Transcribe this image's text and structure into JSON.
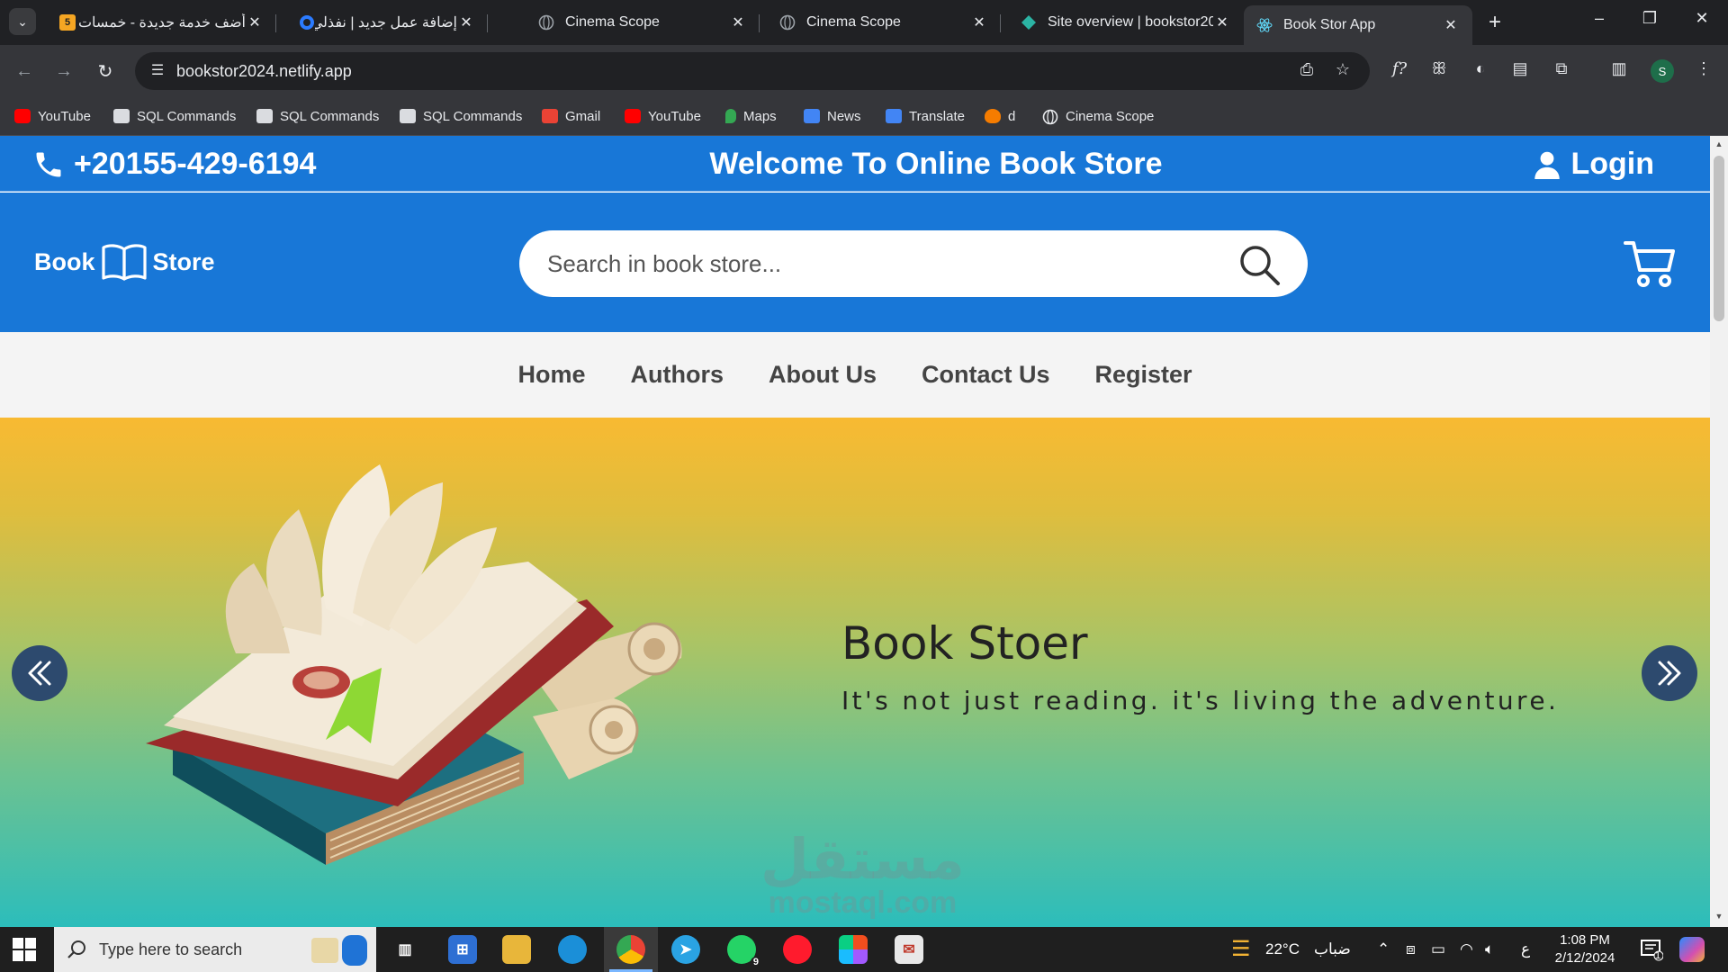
{
  "browser": {
    "tabs": [
      {
        "title": "أضف خدمة جديدة - خمسات",
        "favicon_text": "5",
        "favicon_color": "#f5a623"
      },
      {
        "title": "إضافة عمل جديد | نفذلي",
        "favicon_text": "",
        "favicon_color": "#2b7bff"
      },
      {
        "title": "Cinema Scope",
        "favicon_text": "",
        "favicon_color": "#9aa0a6"
      },
      {
        "title": "Cinema Scope",
        "favicon_text": "",
        "favicon_color": "#9aa0a6"
      },
      {
        "title": "Site overview | bookstor20",
        "favicon_text": "",
        "favicon_color": "#2bb3a3"
      },
      {
        "title": "Book Stor App",
        "favicon_text": "",
        "favicon_color": "#61dafb"
      }
    ],
    "active_tab_index": 5,
    "url": "bookstor2024.netlify.app",
    "profile_initial": "S",
    "bookmarks": [
      {
        "label": "YouTube",
        "icon": "youtube-icon",
        "color": "#ff0000"
      },
      {
        "label": "SQL Commands",
        "icon": "page-icon",
        "color": "#dadce0"
      },
      {
        "label": "SQL Commands",
        "icon": "page-icon",
        "color": "#dadce0"
      },
      {
        "label": "SQL Commands",
        "icon": "page-icon",
        "color": "#dadce0"
      },
      {
        "label": "Gmail",
        "icon": "gmail-icon",
        "color": "#ea4335"
      },
      {
        "label": "YouTube",
        "icon": "youtube-icon",
        "color": "#ff0000"
      },
      {
        "label": "Maps",
        "icon": "maps-icon",
        "color": "#34a853"
      },
      {
        "label": "News",
        "icon": "news-icon",
        "color": "#4285f4"
      },
      {
        "label": "Translate",
        "icon": "translate-icon",
        "color": "#4285f4"
      },
      {
        "label": "d",
        "icon": "fire-icon",
        "color": "#f57c00"
      },
      {
        "label": "Cinema Scope",
        "icon": "globe-icon",
        "color": "#e8eaed"
      }
    ]
  },
  "page": {
    "topbar": {
      "phone": "+20155-429-6194",
      "welcome": "Welcome To Online Book Store",
      "login": "Login"
    },
    "header": {
      "logo_left": "Book",
      "logo_right": "Store",
      "search_placeholder": "Search in book store..."
    },
    "nav": [
      "Home",
      "Authors",
      "About Us",
      "Contact Us",
      "Register"
    ],
    "hero": {
      "title": "Book Stoer",
      "subtitle": "It's not just reading. it's living the adventure."
    },
    "watermark": {
      "arabic": "مستقل",
      "latin": "mostaql.com"
    },
    "colors": {
      "primary": "#1877d7",
      "nav_bg": "#f4f4f4",
      "hero_top": "#f8ba32",
      "hero_bottom": "#2cbdbb",
      "arrow_bg": "#2d4a6e"
    }
  },
  "taskbar": {
    "search_placeholder": "Type here to search",
    "weather_temp": "22°C",
    "weather_text": "ضباب",
    "language": "ع",
    "time": "1:08 PM",
    "date": "2/12/2024",
    "whatsapp_badge": "9",
    "notification_count": "1"
  }
}
